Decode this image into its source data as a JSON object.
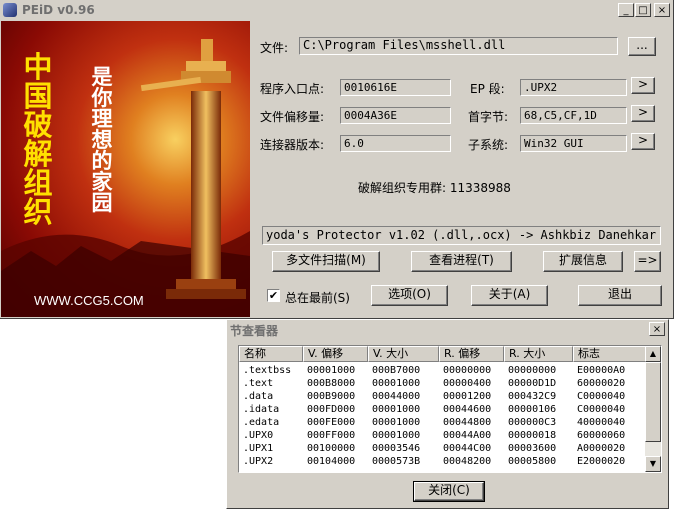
{
  "window": {
    "title": "PEiD v0.96",
    "minimize": "_",
    "maximize": "□",
    "close": "×"
  },
  "banner": {
    "left_text": "中国破解组织",
    "right_text": "是你理想的家园",
    "url": "WWW.CCG5.COM"
  },
  "file": {
    "label": "文件:",
    "value": "C:\\Program Files\\msshell.dll",
    "browse": "..."
  },
  "fields": {
    "entry_point": {
      "label": "程序入口点:",
      "value": "0010616E"
    },
    "ep_section": {
      "label": "EP 段:",
      "value": ".UPX2",
      "button": ">"
    },
    "file_offset": {
      "label": "文件偏移量:",
      "value": "0004A36E"
    },
    "first_bytes": {
      "label": "首字节:",
      "value": "68,C5,CF,1D",
      "button": ">"
    },
    "linker": {
      "label": "连接器版本:",
      "value": "6.0"
    },
    "subsystem": {
      "label": "子系统:",
      "value": "Win32 GUI",
      "button": ">"
    }
  },
  "group_text": "破解组织专用群: 11338988",
  "result": "yoda's Protector v1.02 (.dll,.ocx) -> Ashkbiz Danehkar (",
  "buttons": {
    "multi_scan": "多文件扫描(M)",
    "task_viewer": "查看进程(T)",
    "extra_info": "扩展信息",
    "plugins": "=>",
    "always_on_top": "总在最前(S)",
    "options": "选项(O)",
    "about": "关于(A)",
    "exit": "退出"
  },
  "always_on_top_checked": true,
  "section_viewer": {
    "title": "节查看器",
    "close": "×",
    "columns": [
      "名称",
      "V. 偏移",
      "V. 大小",
      "R. 偏移",
      "R. 大小",
      "标志"
    ],
    "rows": [
      [
        ".textbss",
        "00001000",
        "000B7000",
        "00000000",
        "00000000",
        "E00000A0"
      ],
      [
        ".text",
        "000B8000",
        "00001000",
        "00000400",
        "00000D1D",
        "60000020"
      ],
      [
        ".data",
        "000B9000",
        "00044000",
        "00001200",
        "000432C9",
        "C0000040"
      ],
      [
        ".idata",
        "000FD000",
        "00001000",
        "00044600",
        "00000106",
        "C0000040"
      ],
      [
        ".edata",
        "000FE000",
        "00001000",
        "00044800",
        "000000C3",
        "40000040"
      ],
      [
        ".UPX0",
        "000FF000",
        "00001000",
        "00044A00",
        "00000018",
        "60000060"
      ],
      [
        ".UPX1",
        "00100000",
        "00003546",
        "00044C00",
        "00003600",
        "A0000020"
      ],
      [
        ".UPX2",
        "00104000",
        "0000573B",
        "00048200",
        "00005800",
        "E2000020"
      ]
    ],
    "close_button": "关闭(C)"
  }
}
